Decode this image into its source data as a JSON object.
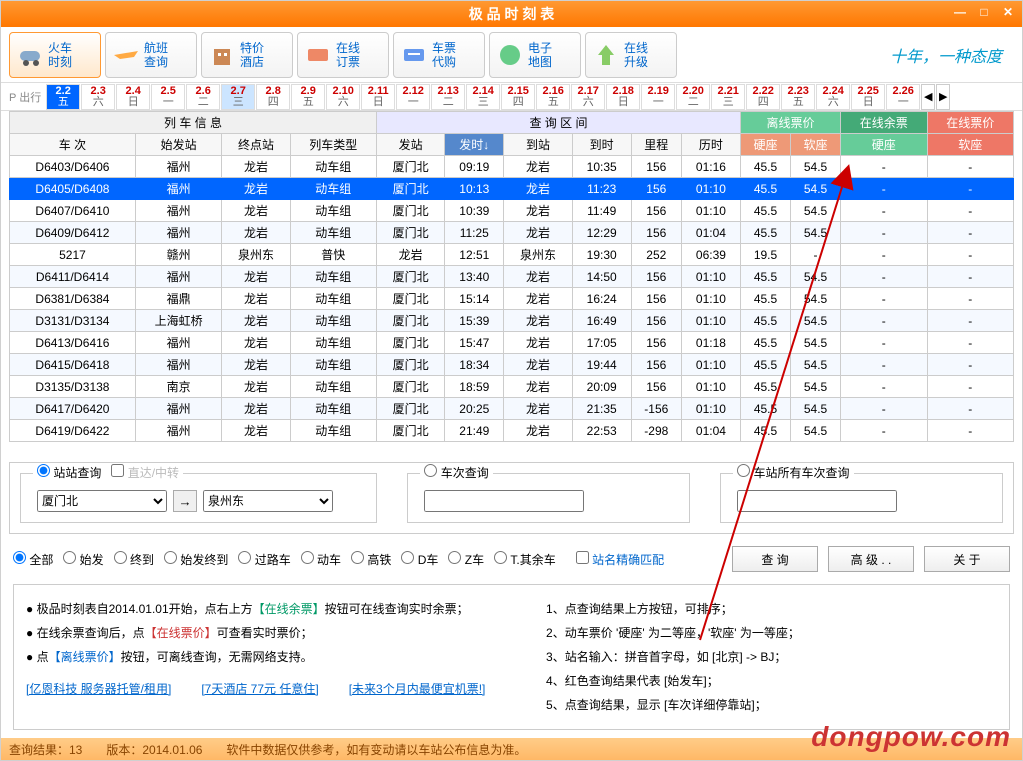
{
  "window": {
    "title": "极 品 时 刻 表"
  },
  "toolbar": {
    "items": [
      {
        "l1": "火车",
        "l2": "时刻"
      },
      {
        "l1": "航班",
        "l2": "查询"
      },
      {
        "l1": "特价",
        "l2": "酒店"
      },
      {
        "l1": "在线",
        "l2": "订票"
      },
      {
        "l1": "车票",
        "l2": "代购"
      },
      {
        "l1": "电子",
        "l2": "地图"
      },
      {
        "l1": "在线",
        "l2": "升级"
      }
    ],
    "slogan": "十年，一种态度"
  },
  "dates": {
    "prefix": "P 出行",
    "cells": [
      {
        "d": "2.2",
        "w": "五",
        "sel": true
      },
      {
        "d": "2.3",
        "w": "六"
      },
      {
        "d": "2.4",
        "w": "日"
      },
      {
        "d": "2.5",
        "w": "一"
      },
      {
        "d": "2.6",
        "w": "二"
      },
      {
        "d": "2.7",
        "w": "三",
        "hl": true
      },
      {
        "d": "2.8",
        "w": "四"
      },
      {
        "d": "2.9",
        "w": "五"
      },
      {
        "d": "2.10",
        "w": "六"
      },
      {
        "d": "2.11",
        "w": "日"
      },
      {
        "d": "2.12",
        "w": "一"
      },
      {
        "d": "2.13",
        "w": "二"
      },
      {
        "d": "2.14",
        "w": "三"
      },
      {
        "d": "2.15",
        "w": "四"
      },
      {
        "d": "2.16",
        "w": "五"
      },
      {
        "d": "2.17",
        "w": "六"
      },
      {
        "d": "2.18",
        "w": "日"
      },
      {
        "d": "2.19",
        "w": "一"
      },
      {
        "d": "2.20",
        "w": "二"
      },
      {
        "d": "2.21",
        "w": "三"
      },
      {
        "d": "2.22",
        "w": "四"
      },
      {
        "d": "2.23",
        "w": "五"
      },
      {
        "d": "2.24",
        "w": "六"
      },
      {
        "d": "2.25",
        "w": "日"
      },
      {
        "d": "2.26",
        "w": "一"
      }
    ]
  },
  "grid": {
    "groups": {
      "g1": "列 车 信 息",
      "g2": "查 询 区 间",
      "g3": "离线票价",
      "g4": "在线余票",
      "g5": "在线票价"
    },
    "headers": [
      "车 次",
      "始发站",
      "终点站",
      "列车类型",
      "发站",
      "发时↓",
      "到站",
      "到时",
      "里程",
      "历时",
      "硬座",
      "软座",
      "硬座",
      "软座"
    ],
    "rows": [
      {
        "c": [
          "D6403/D6406",
          "福州",
          "龙岩",
          "动车组",
          "厦门北",
          "09:19",
          "龙岩",
          "10:35",
          "156",
          "01:16",
          "45.5",
          "54.5",
          "-",
          "-"
        ]
      },
      {
        "c": [
          "D6405/D6408",
          "福州",
          "龙岩",
          "动车组",
          "厦门北",
          "10:13",
          "龙岩",
          "11:23",
          "156",
          "01:10",
          "45.5",
          "54.5",
          "-",
          "-"
        ],
        "sel": true
      },
      {
        "c": [
          "D6407/D6410",
          "福州",
          "龙岩",
          "动车组",
          "厦门北",
          "10:39",
          "龙岩",
          "11:49",
          "156",
          "01:10",
          "45.5",
          "54.5",
          "-",
          "-"
        ]
      },
      {
        "c": [
          "D6409/D6412",
          "福州",
          "龙岩",
          "动车组",
          "厦门北",
          "11:25",
          "龙岩",
          "12:29",
          "156",
          "01:04",
          "45.5",
          "54.5",
          "-",
          "-"
        ]
      },
      {
        "c": [
          "5217",
          "赣州",
          "泉州东",
          "普快",
          "龙岩",
          "12:51",
          "泉州东",
          "19:30",
          "252",
          "06:39",
          "19.5",
          "-",
          "-",
          "-"
        ]
      },
      {
        "c": [
          "D6411/D6414",
          "福州",
          "龙岩",
          "动车组",
          "厦门北",
          "13:40",
          "龙岩",
          "14:50",
          "156",
          "01:10",
          "45.5",
          "54.5",
          "-",
          "-"
        ]
      },
      {
        "c": [
          "D6381/D6384",
          "福鼎",
          "龙岩",
          "动车组",
          "厦门北",
          "15:14",
          "龙岩",
          "16:24",
          "156",
          "01:10",
          "45.5",
          "54.5",
          "-",
          "-"
        ]
      },
      {
        "c": [
          "D3131/D3134",
          "上海虹桥",
          "龙岩",
          "动车组",
          "厦门北",
          "15:39",
          "龙岩",
          "16:49",
          "156",
          "01:10",
          "45.5",
          "54.5",
          "-",
          "-"
        ]
      },
      {
        "c": [
          "D6413/D6416",
          "福州",
          "龙岩",
          "动车组",
          "厦门北",
          "15:47",
          "龙岩",
          "17:05",
          "156",
          "01:18",
          "45.5",
          "54.5",
          "-",
          "-"
        ]
      },
      {
        "c": [
          "D6415/D6418",
          "福州",
          "龙岩",
          "动车组",
          "厦门北",
          "18:34",
          "龙岩",
          "19:44",
          "156",
          "01:10",
          "45.5",
          "54.5",
          "-",
          "-"
        ]
      },
      {
        "c": [
          "D3135/D3138",
          "南京",
          "龙岩",
          "动车组",
          "厦门北",
          "18:59",
          "龙岩",
          "20:09",
          "156",
          "01:10",
          "45.5",
          "54.5",
          "-",
          "-"
        ]
      },
      {
        "c": [
          "D6417/D6420",
          "福州",
          "龙岩",
          "动车组",
          "厦门北",
          "20:25",
          "龙岩",
          "21:35",
          "-156",
          "01:10",
          "45.5",
          "54.5",
          "-",
          "-"
        ]
      },
      {
        "c": [
          "D6419/D6422",
          "福州",
          "龙岩",
          "动车组",
          "厦门北",
          "21:49",
          "龙岩",
          "22:53",
          "-298",
          "01:04",
          "45.5",
          "54.5",
          "-",
          "-"
        ]
      }
    ]
  },
  "query": {
    "tab1": "站站查询",
    "tab1b": "直达/中转",
    "tab2": "车次查询",
    "tab3": "车站所有车次查询",
    "from": "厦门北",
    "to": "泉州东",
    "filters": [
      "全部",
      "始发",
      "终到",
      "始发终到",
      "过路车",
      "动车",
      "高铁",
      "D车",
      "Z车",
      "T.其余车"
    ],
    "exact": "站名精确匹配",
    "btn_query": "查  询",
    "btn_adv": "高 级 . .",
    "btn_about": "关  于"
  },
  "info": {
    "l1a": "极品时刻表自2014.01.01开始，点右上方",
    "l1b": "【在线余票】",
    "l1c": "按钮可在线查询实时余票；",
    "l2a": "在线余票查询后，点",
    "l2b": "【在线票价】",
    "l2c": "可查看实时票价；",
    "l3a": "点",
    "l3b": "【离线票价】",
    "l3c": "按钮，可离线查询，无需网络支持。",
    "links": [
      "[亿恩科技 服务器托管/租用]",
      "[7天酒店 77元 任意住]",
      "[未来3个月内最便宜机票!]"
    ],
    "r": [
      "1、点查询结果上方按钮，可排序；",
      "2、动车票价 '硬座' 为二等座，'软座' 为一等座；",
      "3、站名输入：拼音首字母，如 [北京] -> BJ；",
      "4、红色查询结果代表 [始发车]；",
      "5、点查询结果，显示 [车次详细停靠站]；"
    ]
  },
  "status": {
    "s1": "查询结果：13",
    "s2": "版本：2014.01.06",
    "s3": "软件中数据仅供参考，如有变动请以车站公布信息为准。"
  },
  "watermark": "dongpow.com"
}
